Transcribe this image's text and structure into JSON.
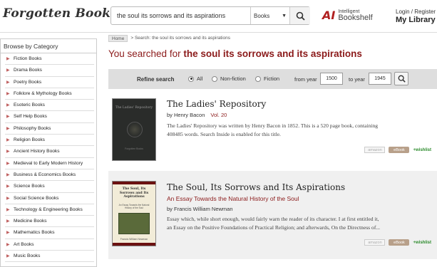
{
  "header": {
    "logo": "Forgotten Books",
    "search_value": "the soul its sorrows and its aspirations",
    "search_category": "Books",
    "ib_mark": "AI",
    "ib_small": "Intelligent",
    "ib_big": "Bookshelf",
    "login": "Login / Register",
    "my_library": "My Library"
  },
  "sidebar": {
    "title": "Browse by Category",
    "items": [
      "Fiction Books",
      "Drama Books",
      "Poetry Books",
      "Folklore & Mythology Books",
      "Esoteric Books",
      "Self Help Books",
      "Philosophy Books",
      "Religion Books",
      "Ancient History Books",
      "Medieval to Early Modern History",
      "Business & Economics Books",
      "Science Books",
      "Social Science Books",
      "Technology & Engineering Books",
      "Medicine Books",
      "Mathematics Books",
      "Art Books",
      "Music Books"
    ]
  },
  "breadcrumb": {
    "home": "Home",
    "trail": "> Search: the soul its sorrows and its aspirations"
  },
  "heading": {
    "prefix": "You searched for",
    "query": "the soul its sorrows and its aspirations"
  },
  "refine": {
    "label": "Refine search",
    "options": [
      "All",
      "Non-fiction",
      "Fiction"
    ],
    "selected": "All",
    "from_label": "from year",
    "from_value": "1500",
    "to_label": "to year",
    "to_value": "1945"
  },
  "results": [
    {
      "title": "The Ladies' Repository",
      "subtitle": "",
      "author": "by Henry Bacon",
      "volume": "Vol. 20",
      "description": "The Ladies' Repository was written by Henry Bacon in 1852. This is a 520 page book, containing",
      "description2": "408485 words. Search Inside is enabled for this title.",
      "cover_title": "The Ladies' Repository",
      "cover_publisher": "Forgotten Books",
      "amazon": "amazon",
      "ebook": "eBook",
      "wishlist": "+wishlist"
    },
    {
      "title": "The Soul, Its Sorrows and Its Aspirations",
      "subtitle": "An Essay Towards the Natural History of the Soul",
      "author": "by Francis William Newman",
      "volume": "",
      "description": "Essay which, while short enough, would fairly warn the reader of its character. I at first entitled it,",
      "description2": "an Essay on the Positive Foundations of Practical Religion; and afterwards, On the Directness of...",
      "cover_title": "The Soul, Its Sorrows and Its Aspirations",
      "cover_subtitle": "An Essay Towards the Natural History of the Soul",
      "cover_publisher": "Francis William Newman",
      "amazon": "amazon",
      "ebook": "eBook",
      "wishlist": "+wishlist"
    }
  ],
  "colors": {
    "accent_red": "#8b1a1a",
    "wishlist_green": "#2a8a2a",
    "refine_bg": "#dedede"
  }
}
